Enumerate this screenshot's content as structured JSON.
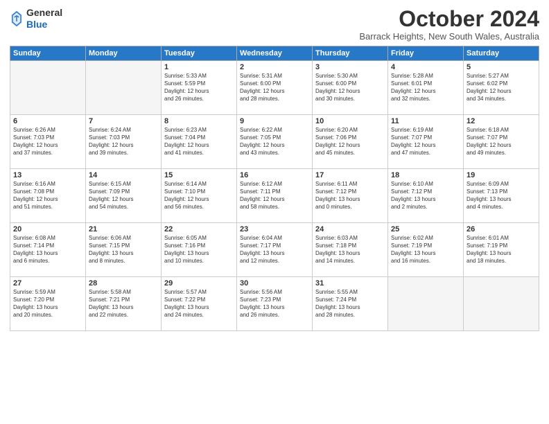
{
  "logo": {
    "general": "General",
    "blue": "Blue"
  },
  "header": {
    "month": "October 2024",
    "location": "Barrack Heights, New South Wales, Australia"
  },
  "days_of_week": [
    "Sunday",
    "Monday",
    "Tuesday",
    "Wednesday",
    "Thursday",
    "Friday",
    "Saturday"
  ],
  "weeks": [
    [
      {
        "day": "",
        "content": ""
      },
      {
        "day": "",
        "content": ""
      },
      {
        "day": "1",
        "content": "Sunrise: 5:33 AM\nSunset: 5:59 PM\nDaylight: 12 hours\nand 26 minutes."
      },
      {
        "day": "2",
        "content": "Sunrise: 5:31 AM\nSunset: 6:00 PM\nDaylight: 12 hours\nand 28 minutes."
      },
      {
        "day": "3",
        "content": "Sunrise: 5:30 AM\nSunset: 6:00 PM\nDaylight: 12 hours\nand 30 minutes."
      },
      {
        "day": "4",
        "content": "Sunrise: 5:28 AM\nSunset: 6:01 PM\nDaylight: 12 hours\nand 32 minutes."
      },
      {
        "day": "5",
        "content": "Sunrise: 5:27 AM\nSunset: 6:02 PM\nDaylight: 12 hours\nand 34 minutes."
      }
    ],
    [
      {
        "day": "6",
        "content": "Sunrise: 6:26 AM\nSunset: 7:03 PM\nDaylight: 12 hours\nand 37 minutes."
      },
      {
        "day": "7",
        "content": "Sunrise: 6:24 AM\nSunset: 7:03 PM\nDaylight: 12 hours\nand 39 minutes."
      },
      {
        "day": "8",
        "content": "Sunrise: 6:23 AM\nSunset: 7:04 PM\nDaylight: 12 hours\nand 41 minutes."
      },
      {
        "day": "9",
        "content": "Sunrise: 6:22 AM\nSunset: 7:05 PM\nDaylight: 12 hours\nand 43 minutes."
      },
      {
        "day": "10",
        "content": "Sunrise: 6:20 AM\nSunset: 7:06 PM\nDaylight: 12 hours\nand 45 minutes."
      },
      {
        "day": "11",
        "content": "Sunrise: 6:19 AM\nSunset: 7:07 PM\nDaylight: 12 hours\nand 47 minutes."
      },
      {
        "day": "12",
        "content": "Sunrise: 6:18 AM\nSunset: 7:07 PM\nDaylight: 12 hours\nand 49 minutes."
      }
    ],
    [
      {
        "day": "13",
        "content": "Sunrise: 6:16 AM\nSunset: 7:08 PM\nDaylight: 12 hours\nand 51 minutes."
      },
      {
        "day": "14",
        "content": "Sunrise: 6:15 AM\nSunset: 7:09 PM\nDaylight: 12 hours\nand 54 minutes."
      },
      {
        "day": "15",
        "content": "Sunrise: 6:14 AM\nSunset: 7:10 PM\nDaylight: 12 hours\nand 56 minutes."
      },
      {
        "day": "16",
        "content": "Sunrise: 6:12 AM\nSunset: 7:11 PM\nDaylight: 12 hours\nand 58 minutes."
      },
      {
        "day": "17",
        "content": "Sunrise: 6:11 AM\nSunset: 7:12 PM\nDaylight: 13 hours\nand 0 minutes."
      },
      {
        "day": "18",
        "content": "Sunrise: 6:10 AM\nSunset: 7:12 PM\nDaylight: 13 hours\nand 2 minutes."
      },
      {
        "day": "19",
        "content": "Sunrise: 6:09 AM\nSunset: 7:13 PM\nDaylight: 13 hours\nand 4 minutes."
      }
    ],
    [
      {
        "day": "20",
        "content": "Sunrise: 6:08 AM\nSunset: 7:14 PM\nDaylight: 13 hours\nand 6 minutes."
      },
      {
        "day": "21",
        "content": "Sunrise: 6:06 AM\nSunset: 7:15 PM\nDaylight: 13 hours\nand 8 minutes."
      },
      {
        "day": "22",
        "content": "Sunrise: 6:05 AM\nSunset: 7:16 PM\nDaylight: 13 hours\nand 10 minutes."
      },
      {
        "day": "23",
        "content": "Sunrise: 6:04 AM\nSunset: 7:17 PM\nDaylight: 13 hours\nand 12 minutes."
      },
      {
        "day": "24",
        "content": "Sunrise: 6:03 AM\nSunset: 7:18 PM\nDaylight: 13 hours\nand 14 minutes."
      },
      {
        "day": "25",
        "content": "Sunrise: 6:02 AM\nSunset: 7:19 PM\nDaylight: 13 hours\nand 16 minutes."
      },
      {
        "day": "26",
        "content": "Sunrise: 6:01 AM\nSunset: 7:19 PM\nDaylight: 13 hours\nand 18 minutes."
      }
    ],
    [
      {
        "day": "27",
        "content": "Sunrise: 5:59 AM\nSunset: 7:20 PM\nDaylight: 13 hours\nand 20 minutes."
      },
      {
        "day": "28",
        "content": "Sunrise: 5:58 AM\nSunset: 7:21 PM\nDaylight: 13 hours\nand 22 minutes."
      },
      {
        "day": "29",
        "content": "Sunrise: 5:57 AM\nSunset: 7:22 PM\nDaylight: 13 hours\nand 24 minutes."
      },
      {
        "day": "30",
        "content": "Sunrise: 5:56 AM\nSunset: 7:23 PM\nDaylight: 13 hours\nand 26 minutes."
      },
      {
        "day": "31",
        "content": "Sunrise: 5:55 AM\nSunset: 7:24 PM\nDaylight: 13 hours\nand 28 minutes."
      },
      {
        "day": "",
        "content": ""
      },
      {
        "day": "",
        "content": ""
      }
    ]
  ]
}
